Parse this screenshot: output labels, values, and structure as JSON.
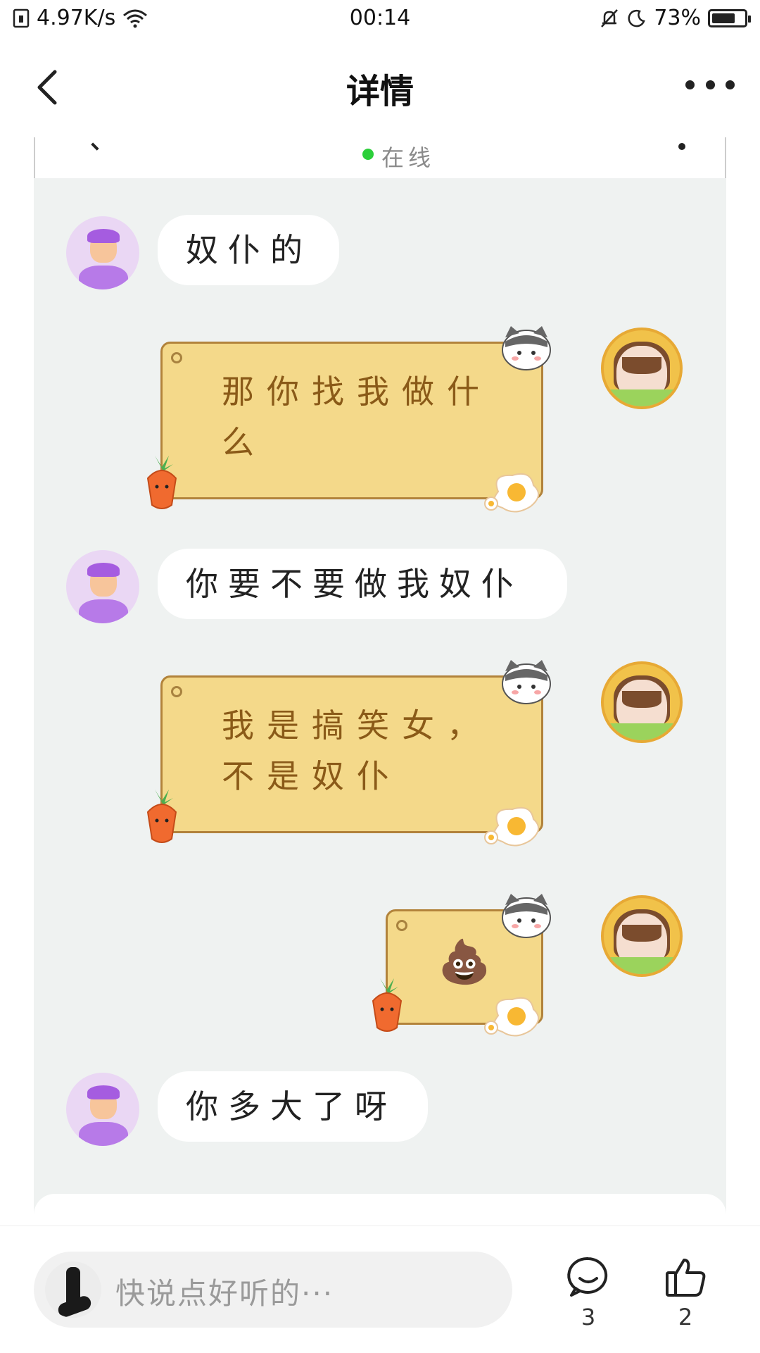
{
  "status_bar": {
    "net_speed": "4.97K/s",
    "time": "00:14",
    "battery": "73%",
    "battery_level": 0.73
  },
  "nav": {
    "title": "详情"
  },
  "screenshot": {
    "online_status": "在线",
    "messages": [
      {
        "from": "other",
        "text": "奴仆的"
      },
      {
        "from": "me",
        "text": "那你找我做什么"
      },
      {
        "from": "other",
        "text": "你要不要做我奴仆"
      },
      {
        "from": "me",
        "text": "我是搞笑女，不是奴仆"
      },
      {
        "from": "me",
        "text": "💩"
      },
      {
        "from": "other",
        "text": "你多大了呀"
      }
    ]
  },
  "bottom_bar": {
    "comment_placeholder": "快说点好听的···",
    "comment_count": "3",
    "like_count": "2"
  },
  "icons": {
    "back": "back-arrow-icon",
    "more": "more-dots-icon",
    "comment": "comment-bubble-icon",
    "like": "thumbs-up-icon"
  }
}
